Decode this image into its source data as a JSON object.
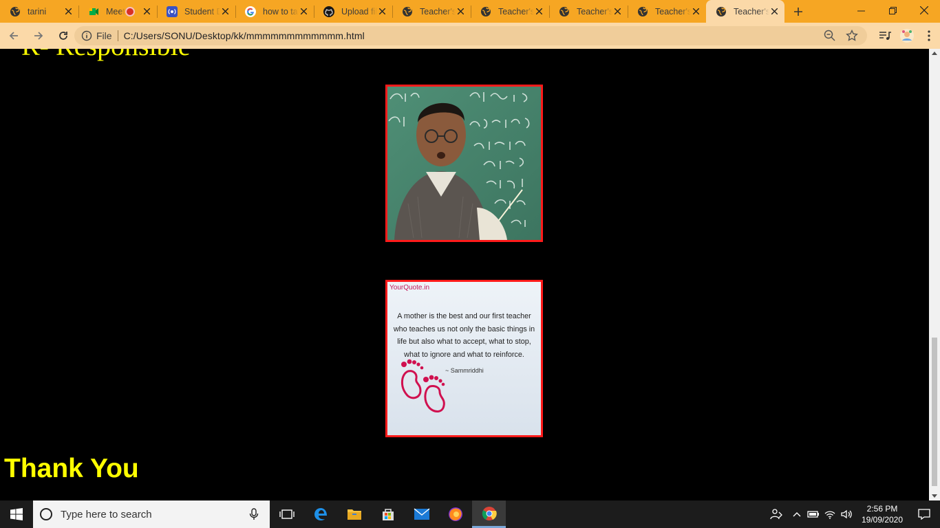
{
  "browser": {
    "tabs": [
      {
        "title": "tarini",
        "icon": "globe-icon"
      },
      {
        "title": "Meet",
        "icon": "meet-icon",
        "recording": true
      },
      {
        "title": "Student Dashboard",
        "icon": "radio-icon"
      },
      {
        "title": "how to take",
        "icon": "google-icon"
      },
      {
        "title": "Upload files",
        "icon": "github-icon"
      },
      {
        "title": "Teacher's",
        "icon": "globe-icon"
      },
      {
        "title": "Teacher's",
        "icon": "globe-icon"
      },
      {
        "title": "Teacher's",
        "icon": "globe-icon"
      },
      {
        "title": "Teacher's",
        "icon": "globe-icon"
      },
      {
        "title": "Teacher's",
        "icon": "globe-icon",
        "active": true
      }
    ],
    "address": {
      "scheme_chip": "File",
      "url": "C:/Users/SONU/Desktop/kk/mmmmmmmmmmmm.html"
    },
    "accent_color": "#f6a623"
  },
  "page": {
    "heading_partial": "R- Responsible",
    "quote_card": {
      "brand": "YourQuote.in",
      "quote": "A mother is the best and our first teacher who teaches us not only the basic things in life but also what to accept, what to stop, what to ignore and what to reinforce.",
      "author": "~ Sammriddhi"
    },
    "closing": "Thank You",
    "text_color": "#ffff00",
    "frame_color": "#ff1a1a"
  },
  "taskbar": {
    "search_placeholder": "Type here to search",
    "time": "2:56 PM",
    "date": "19/09/2020"
  }
}
